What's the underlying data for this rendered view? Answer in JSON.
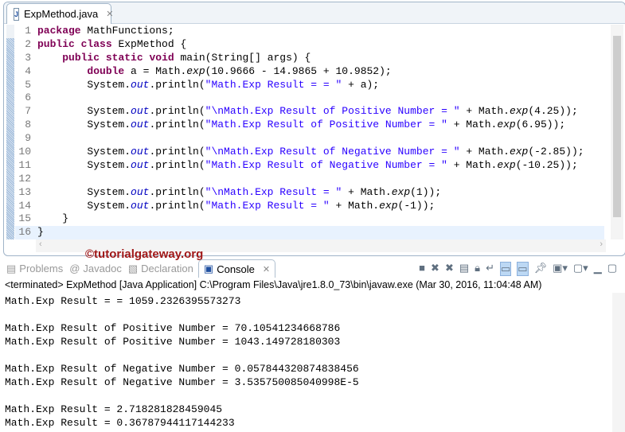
{
  "editor": {
    "tab_title": "ExpMethod.java",
    "lines": [
      [
        [
          "package",
          "kw"
        ],
        [
          " MathFunctions;",
          ""
        ]
      ],
      [
        [
          "public",
          "kw"
        ],
        [
          " ",
          ""
        ],
        [
          "class",
          "kw"
        ],
        [
          " ExpMethod {",
          ""
        ]
      ],
      [
        [
          "    ",
          ""
        ],
        [
          "public",
          "kw"
        ],
        [
          " ",
          ""
        ],
        [
          "static",
          "kw"
        ],
        [
          " ",
          ""
        ],
        [
          "void",
          "kw"
        ],
        [
          " main(String[] args) {",
          ""
        ]
      ],
      [
        [
          "        ",
          ""
        ],
        [
          "double",
          "kw"
        ],
        [
          " a = Math.",
          ""
        ],
        [
          "exp",
          "it"
        ],
        [
          "(10.9666 - 14.9865 + 10.9852);",
          ""
        ]
      ],
      [
        [
          "        System.",
          ""
        ],
        [
          "out",
          "fld"
        ],
        [
          ".println(",
          ""
        ],
        [
          "\"Math.Exp Result = = \"",
          "str"
        ],
        [
          " + a);",
          ""
        ]
      ],
      [],
      [
        [
          "        System.",
          ""
        ],
        [
          "out",
          "fld"
        ],
        [
          ".println(",
          ""
        ],
        [
          "\"\\nMath.Exp Result of Positive Number = \"",
          "str"
        ],
        [
          " + Math.",
          ""
        ],
        [
          "exp",
          "it"
        ],
        [
          "(4.25));",
          ""
        ]
      ],
      [
        [
          "        System.",
          ""
        ],
        [
          "out",
          "fld"
        ],
        [
          ".println(",
          ""
        ],
        [
          "\"Math.Exp Result of Positive Number = \"",
          "str"
        ],
        [
          " + Math.",
          ""
        ],
        [
          "exp",
          "it"
        ],
        [
          "(6.95));",
          ""
        ]
      ],
      [],
      [
        [
          "        System.",
          ""
        ],
        [
          "out",
          "fld"
        ],
        [
          ".println(",
          ""
        ],
        [
          "\"\\nMath.Exp Result of Negative Number = \"",
          "str"
        ],
        [
          " + Math.",
          ""
        ],
        [
          "exp",
          "it"
        ],
        [
          "(-2.85));",
          ""
        ]
      ],
      [
        [
          "        System.",
          ""
        ],
        [
          "out",
          "fld"
        ],
        [
          ".println(",
          ""
        ],
        [
          "\"Math.Exp Result of Negative Number = \"",
          "str"
        ],
        [
          " + Math.",
          ""
        ],
        [
          "exp",
          "it"
        ],
        [
          "(-10.25));",
          ""
        ]
      ],
      [],
      [
        [
          "        System.",
          ""
        ],
        [
          "out",
          "fld"
        ],
        [
          ".println(",
          ""
        ],
        [
          "\"\\nMath.Exp Result = \"",
          "str"
        ],
        [
          " + Math.",
          ""
        ],
        [
          "exp",
          "it"
        ],
        [
          "(1));",
          ""
        ]
      ],
      [
        [
          "        System.",
          ""
        ],
        [
          "out",
          "fld"
        ],
        [
          ".println(",
          ""
        ],
        [
          "\"Math.Exp Result = \"",
          "str"
        ],
        [
          " + Math.",
          ""
        ],
        [
          "exp",
          "it"
        ],
        [
          "(-1));",
          ""
        ]
      ],
      [
        [
          "    }",
          ""
        ]
      ],
      [
        [
          "}",
          ""
        ]
      ]
    ]
  },
  "watermark": "©tutorialgateway.org",
  "views": {
    "tabs": [
      "Problems",
      "Javadoc",
      "Declaration",
      "Console"
    ],
    "active": "Console"
  },
  "console": {
    "status": "<terminated> ExpMethod [Java Application] C:\\Program Files\\Java\\jre1.8.0_73\\bin\\javaw.exe (Mar 30, 2016, 11:04:48 AM)",
    "output": [
      "Math.Exp Result = = 1059.2326395573273",
      "",
      "Math.Exp Result of Positive Number = 70.10541234668786",
      "Math.Exp Result of Positive Number = 1043.149728180303",
      "",
      "Math.Exp Result of Negative Number = 0.057844320874838456",
      "Math.Exp Result of Negative Number = 3.535750085040998E-5",
      "",
      "Math.Exp Result = 2.718281828459045",
      "Math.Exp Result = 0.36787944117144233"
    ]
  }
}
